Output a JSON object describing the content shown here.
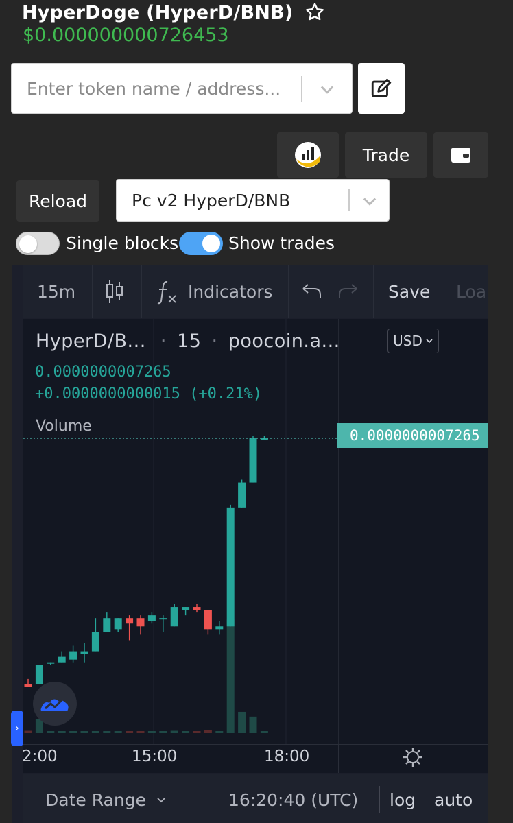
{
  "header": {
    "title": "HyperDoge (HyperD/BNB)",
    "price": "$0.000000000726453"
  },
  "search": {
    "placeholder": "Enter token name / address..."
  },
  "buttons": {
    "trade": "Trade",
    "reload": "Reload"
  },
  "pair_select": {
    "value": "Pc v2 HyperD/BNB"
  },
  "toggles": {
    "single_blocks": {
      "label": "Single blocks",
      "on": false
    },
    "show_trades": {
      "label": "Show trades",
      "on": true
    }
  },
  "toolbar": {
    "interval": "15m",
    "indicators": "Indicators",
    "save": "Save",
    "load": "Loa"
  },
  "legend": {
    "symbol": "HyperD/B...",
    "interval": "15",
    "source": "poocoin.a...",
    "price": "0.0000000007265",
    "change": "+0.0000000000015 (+0.21%)",
    "volume_label": "Volume"
  },
  "currency": "USD",
  "price_label": "0.0000000007265",
  "time_axis": [
    "2:00",
    "15:00",
    "18:00"
  ],
  "bottom": {
    "date_range": "Date Range",
    "time": "16:20:40 (UTC)",
    "log": "log",
    "auto": "auto"
  },
  "colors": {
    "up": "#26a69a",
    "down": "#ef5350",
    "accent_green": "#3fb950",
    "toggle_on": "#4ea4f5"
  },
  "chart_data": {
    "type": "candlestick",
    "candles": [
      {
        "o": 0.2,
        "h": 0.22,
        "l": 0.19,
        "c": 0.19,
        "v": 0.5
      },
      {
        "o": 0.2,
        "h": 0.27,
        "l": 0.2,
        "c": 0.27,
        "v": 3.0
      },
      {
        "o": 0.28,
        "h": 0.28,
        "l": 0.27,
        "c": 0.28,
        "v": 0.3
      },
      {
        "o": 0.28,
        "h": 0.32,
        "l": 0.28,
        "c": 0.3,
        "v": 0.3
      },
      {
        "o": 0.29,
        "h": 0.34,
        "l": 0.28,
        "c": 0.32,
        "v": 0.3
      },
      {
        "o": 0.31,
        "h": 0.35,
        "l": 0.28,
        "c": 0.32,
        "v": 0.2
      },
      {
        "o": 0.32,
        "h": 0.44,
        "l": 0.32,
        "c": 0.39,
        "v": 0.3
      },
      {
        "o": 0.39,
        "h": 0.46,
        "l": 0.39,
        "c": 0.44,
        "v": 0.3
      },
      {
        "o": 0.4,
        "h": 0.44,
        "l": 0.39,
        "c": 0.44,
        "v": 0.3
      },
      {
        "o": 0.44,
        "h": 0.45,
        "l": 0.36,
        "c": 0.42,
        "v": 0.3
      },
      {
        "o": 0.44,
        "h": 0.45,
        "l": 0.38,
        "c": 0.41,
        "v": 0.3
      },
      {
        "o": 0.43,
        "h": 0.46,
        "l": 0.42,
        "c": 0.45,
        "v": 0.3
      },
      {
        "o": 0.44,
        "h": 0.45,
        "l": 0.39,
        "c": 0.44,
        "v": 0.3
      },
      {
        "o": 0.41,
        "h": 0.49,
        "l": 0.41,
        "c": 0.48,
        "v": 0.5
      },
      {
        "o": 0.47,
        "h": 0.48,
        "l": 0.45,
        "c": 0.48,
        "v": 0.3
      },
      {
        "o": 0.48,
        "h": 0.49,
        "l": 0.46,
        "c": 0.47,
        "v": 0.3
      },
      {
        "o": 0.47,
        "h": 0.47,
        "l": 0.38,
        "c": 0.4,
        "v": 0.6
      },
      {
        "o": 0.4,
        "h": 0.43,
        "l": 0.38,
        "c": 0.41,
        "v": 0.3
      },
      {
        "o": 0.41,
        "h": 0.85,
        "l": 0.41,
        "c": 0.84,
        "v": 24.0
      },
      {
        "o": 0.84,
        "h": 0.94,
        "l": 0.84,
        "c": 0.93,
        "v": 4.5
      },
      {
        "o": 0.93,
        "h": 1.1,
        "l": 0.93,
        "c": 1.09,
        "v": 3.5
      },
      {
        "o": 1.09,
        "h": 1.1,
        "l": 1.09,
        "c": 1.09,
        "v": 0.3
      }
    ]
  }
}
